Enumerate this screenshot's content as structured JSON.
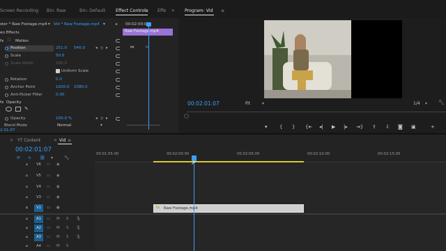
{
  "top_tabs": {
    "screen_recording": "Screen Recording",
    "bin_raw": "Bin: Raw",
    "bin_default": "Bin: Default",
    "effect_controls": "Effect Controls",
    "effe": "Effe",
    "program": "Program: Vid"
  },
  "effect_controls": {
    "source": "ster * Raw Footage.mp4",
    "sequence_clip": "Vid * Raw Footage.mp4",
    "section": "eo Effects",
    "mini_timecode": "00:02:00:0",
    "clip_label": "Raw Footage.mp4",
    "motion": "Motion",
    "position_label": "Position",
    "position_x": "251.0",
    "position_y": "540.0",
    "scale_label": "Scale",
    "scale_value": "50.0",
    "scale_width_label": "Scale Width",
    "scale_width_value": "100.0",
    "uniform_scale": "Uniform Scale",
    "rotation_label": "Rotation",
    "rotation_value": "0.0",
    "anchor_label": "Anchor Point",
    "anchor_x": "1920.0",
    "anchor_y": "1080.0",
    "antiflicker_label": "Anti-flicker Filter",
    "antiflicker_value": "0.00",
    "opacity_section": "Opacity",
    "opacity_label": "Opacity",
    "opacity_value": "100.0 %",
    "blend_label": "Blend Mode",
    "blend_value": "Normal",
    "bottom_timecode": "2:01:07"
  },
  "program_monitor": {
    "timecode": "00:02:01:07",
    "fit": "Fit",
    "resolution": "1/4"
  },
  "timeline": {
    "tab_yt": "YT Content",
    "tab_vid": "Vid",
    "timecode": "00:02:01:07",
    "ruler": [
      "00:01:55:00",
      "00:02:00:00",
      "00:02:05:00",
      "00:02:10:00",
      "00:02:15:00"
    ],
    "clip_name": "Raw Footage.mp4",
    "video_tracks": [
      "V6",
      "V5",
      "V4",
      "V3",
      "V2",
      "V1"
    ],
    "audio_tracks": [
      "A1",
      "A2",
      "A3",
      "A4"
    ],
    "mute": "M",
    "solo": "S"
  },
  "colors": {
    "accent": "#3aa0ff",
    "clip_purple": "#9a73d6",
    "work_area": "#d8c93a"
  }
}
